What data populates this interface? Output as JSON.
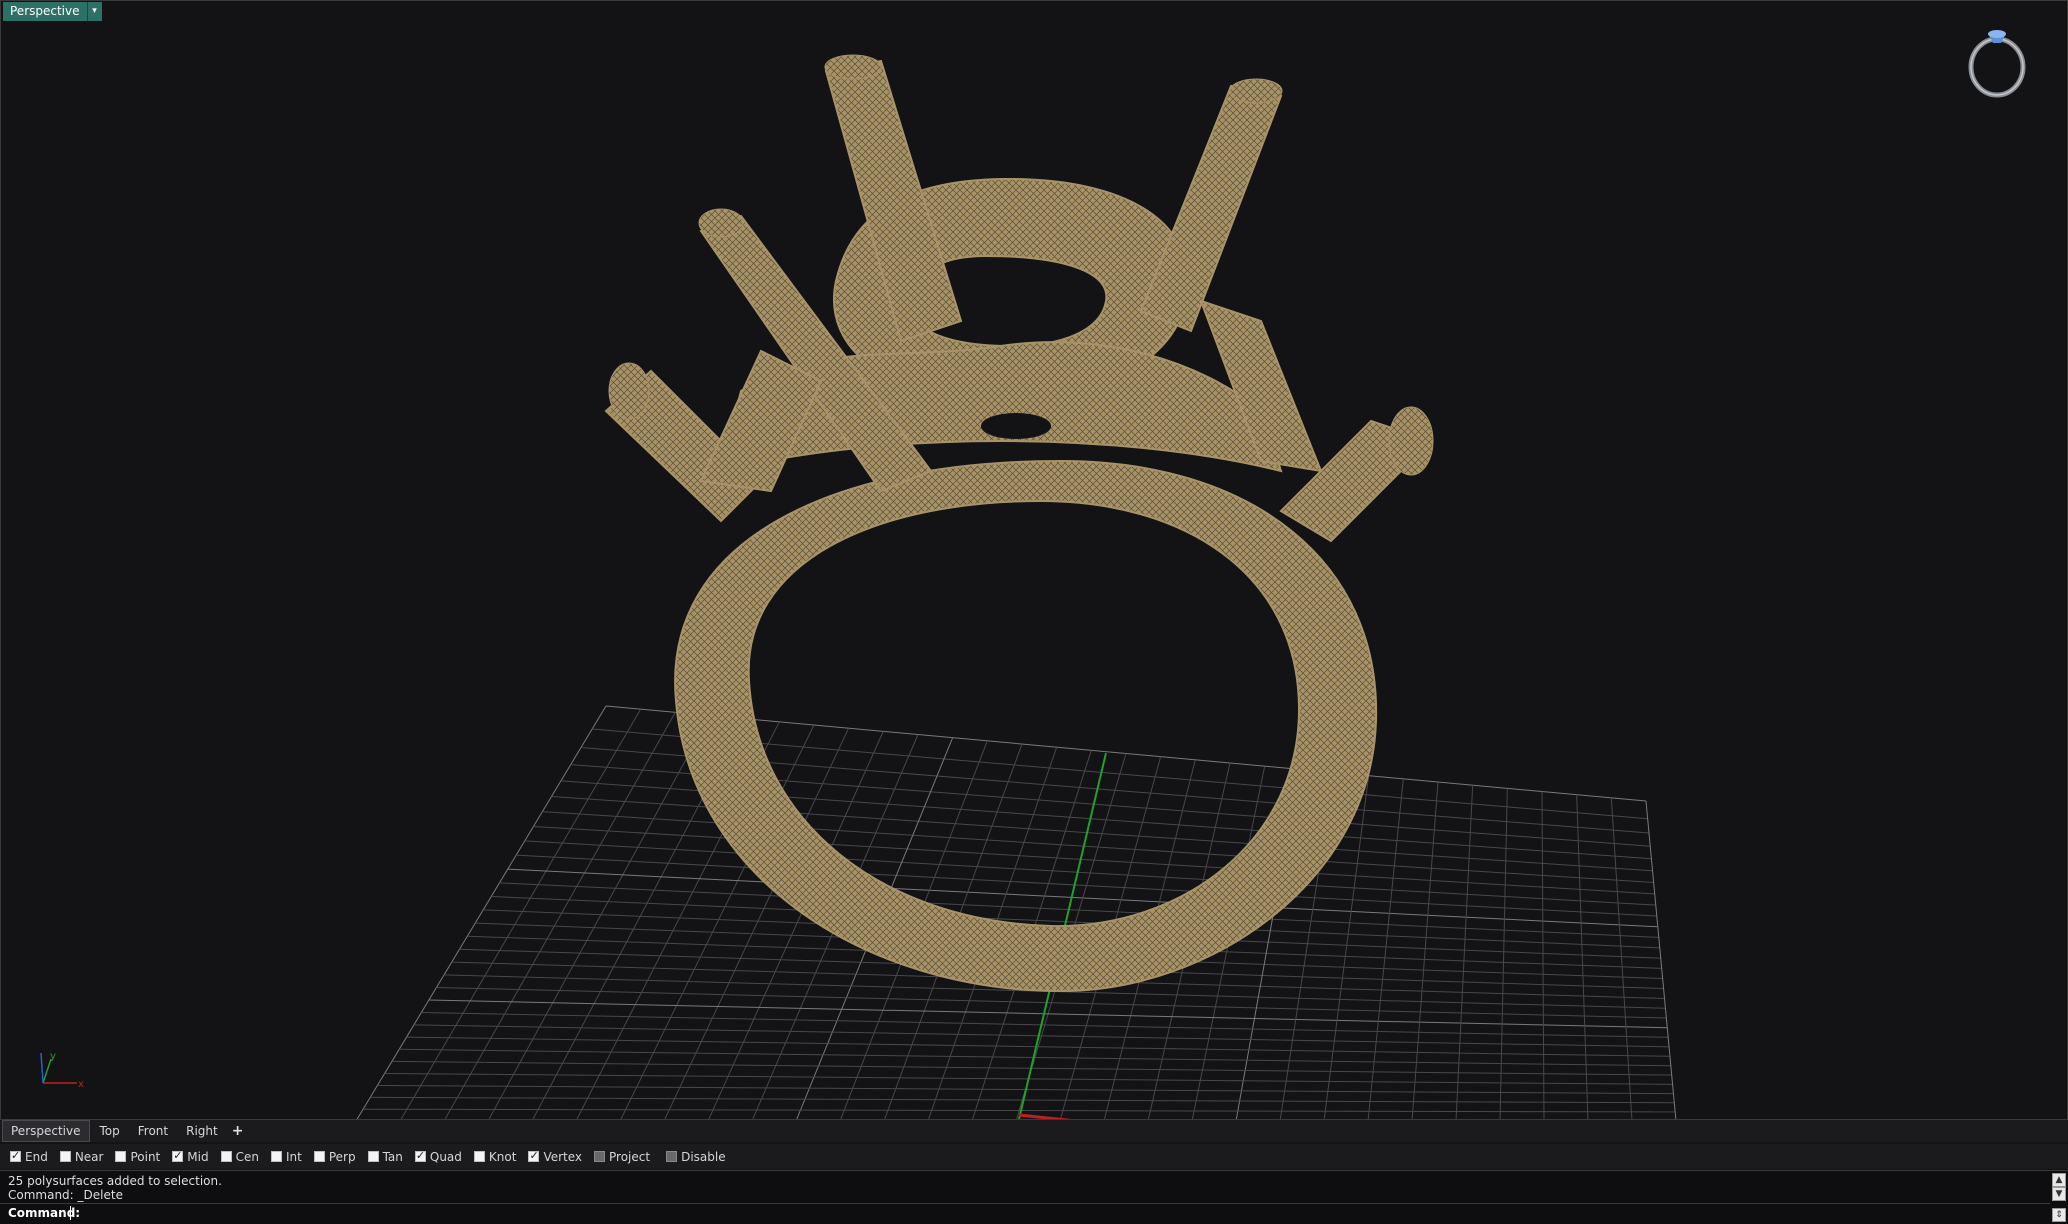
{
  "viewport": {
    "label": "Perspective",
    "menu_caret": "▾"
  },
  "view_tabs": [
    {
      "label": "Perspective",
      "active": true
    },
    {
      "label": "Top",
      "active": false
    },
    {
      "label": "Front",
      "active": false
    },
    {
      "label": "Right",
      "active": false
    }
  ],
  "add_tab": "+",
  "osnaps": [
    {
      "label": "End",
      "checked": true
    },
    {
      "label": "Near",
      "checked": false
    },
    {
      "label": "Point",
      "checked": false
    },
    {
      "label": "Mid",
      "checked": true
    },
    {
      "label": "Cen",
      "checked": false
    },
    {
      "label": "Int",
      "checked": false
    },
    {
      "label": "Perp",
      "checked": false
    },
    {
      "label": "Tan",
      "checked": false
    },
    {
      "label": "Quad",
      "checked": true
    },
    {
      "label": "Knot",
      "checked": false
    },
    {
      "label": "Vertex",
      "checked": true
    },
    {
      "label": "Project",
      "checked": false
    },
    {
      "label": "Disable",
      "checked": false
    }
  ],
  "command_history": [
    "25 polysurfaces added to selection.",
    "Command: _Delete"
  ],
  "command_prompt": "Command:",
  "axes": {
    "x": "x",
    "y": "y"
  },
  "colors": {
    "background": "#131316",
    "model": "#a89368",
    "grid": "#5a5a5e",
    "x_axis": "#c0201c",
    "y_axis": "#1fa22a",
    "label_bg": "#2d7066"
  }
}
